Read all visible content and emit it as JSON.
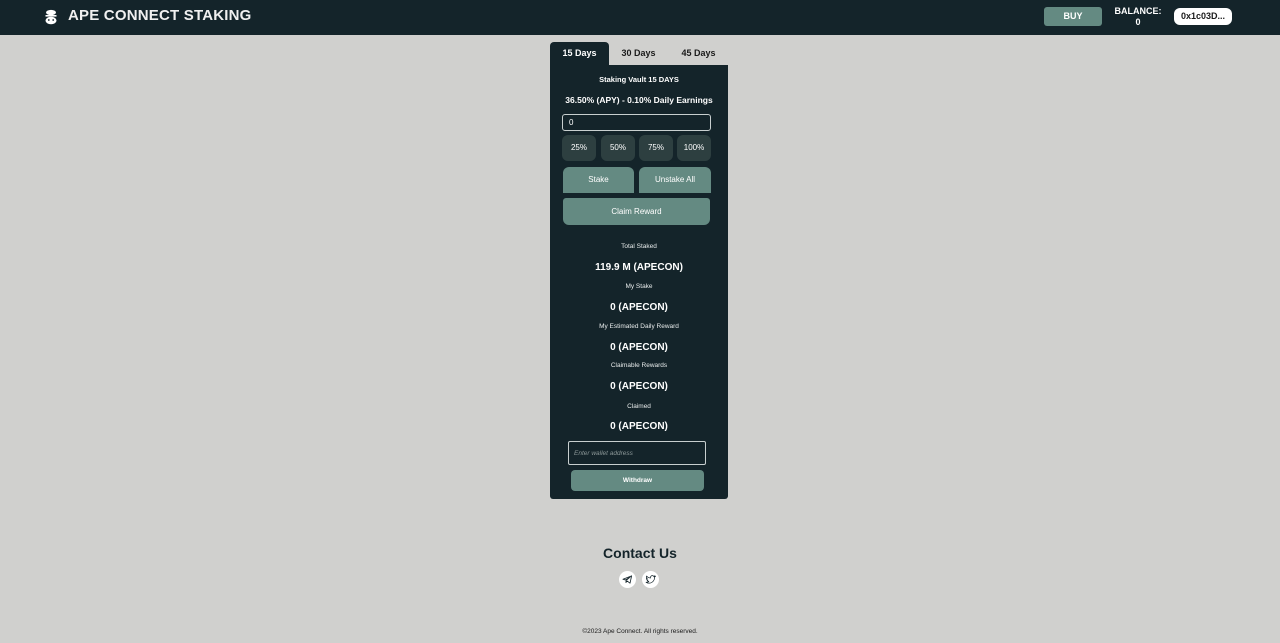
{
  "header": {
    "brand": "APE CONNECT STAKING",
    "buy_label": "BUY",
    "balance_label": "BALANCE:",
    "balance_value": "0",
    "wallet_label": "0x1c03D..."
  },
  "tabs": [
    {
      "label": "15 Days",
      "active": true
    },
    {
      "label": "30 Days",
      "active": false
    },
    {
      "label": "45 Days",
      "active": false
    }
  ],
  "vault": {
    "title": "Staking Vault 15 DAYS",
    "apy": "36.50% (APY) - 0.10% Daily Earnings",
    "amount_value": "0",
    "percent_buttons": [
      "25%",
      "50%",
      "75%",
      "100%"
    ],
    "stake_label": "Stake",
    "unstake_label": "Unstake All",
    "claim_label": "Claim Reward",
    "stats": [
      {
        "label": "Total Staked",
        "value": "119.9 M (APECON)"
      },
      {
        "label": "My Stake",
        "value": "0 (APECON)"
      },
      {
        "label": "My Estimated Daily Reward",
        "value": "0 (APECON)"
      },
      {
        "label": "Claimable Rewards",
        "value": "0 (APECON)"
      },
      {
        "label": "Claimed",
        "value": "0 (APECON)"
      }
    ],
    "address_placeholder": "Enter wallet address",
    "withdraw_label": "Withdraw"
  },
  "footer": {
    "contact_title": "Contact Us",
    "social_icons": [
      "telegram-icon",
      "twitter-icon"
    ],
    "copyright": "©2023 Ape Connect. All rights reserved."
  },
  "colors": {
    "background": "#d0d0ce",
    "header": "#14242a",
    "card": "#14242a",
    "accent": "#648a82",
    "percent_button": "#2d3f40"
  }
}
